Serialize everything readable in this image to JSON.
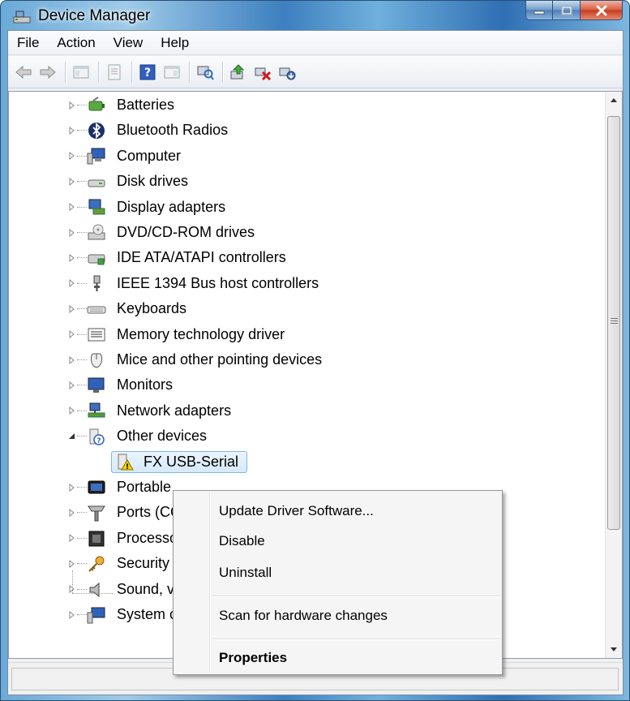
{
  "window": {
    "title": "Device Manager"
  },
  "menu": {
    "file": "File",
    "action": "Action",
    "view": "View",
    "help": "Help"
  },
  "tree": {
    "categories": [
      {
        "label": "Batteries",
        "icon": "battery-icon"
      },
      {
        "label": "Bluetooth Radios",
        "icon": "bluetooth-icon"
      },
      {
        "label": "Computer",
        "icon": "computer-icon"
      },
      {
        "label": "Disk drives",
        "icon": "disk-drive-icon"
      },
      {
        "label": "Display adapters",
        "icon": "display-adapter-icon"
      },
      {
        "label": "DVD/CD-ROM drives",
        "icon": "dvd-drive-icon"
      },
      {
        "label": "IDE ATA/ATAPI controllers",
        "icon": "ide-controller-icon"
      },
      {
        "label": "IEEE 1394 Bus host controllers",
        "icon": "ieee1394-icon"
      },
      {
        "label": "Keyboards",
        "icon": "keyboard-icon"
      },
      {
        "label": "Memory technology driver",
        "icon": "memory-icon"
      },
      {
        "label": "Mice and other pointing devices",
        "icon": "mouse-icon"
      },
      {
        "label": "Monitors",
        "icon": "monitor-icon"
      },
      {
        "label": "Network adapters",
        "icon": "network-adapter-icon"
      },
      {
        "label": "Other devices",
        "icon": "unknown-device-icon"
      },
      {
        "label": "Portable",
        "icon": "portable-device-icon"
      },
      {
        "label": "Ports (CC",
        "icon": "port-icon"
      },
      {
        "label": "Processo",
        "icon": "processor-icon"
      },
      {
        "label": "Security",
        "icon": "security-icon"
      },
      {
        "label": "Sound, v",
        "icon": "sound-icon"
      },
      {
        "label": "System c",
        "icon": "system-device-icon"
      }
    ],
    "child": {
      "label": "FX USB-Serial",
      "icon": "warning-device-icon"
    }
  },
  "context_menu": {
    "update": "Update Driver Software...",
    "disable": "Disable",
    "uninstall": "Uninstall",
    "scan": "Scan for hardware changes",
    "properties": "Properties"
  }
}
